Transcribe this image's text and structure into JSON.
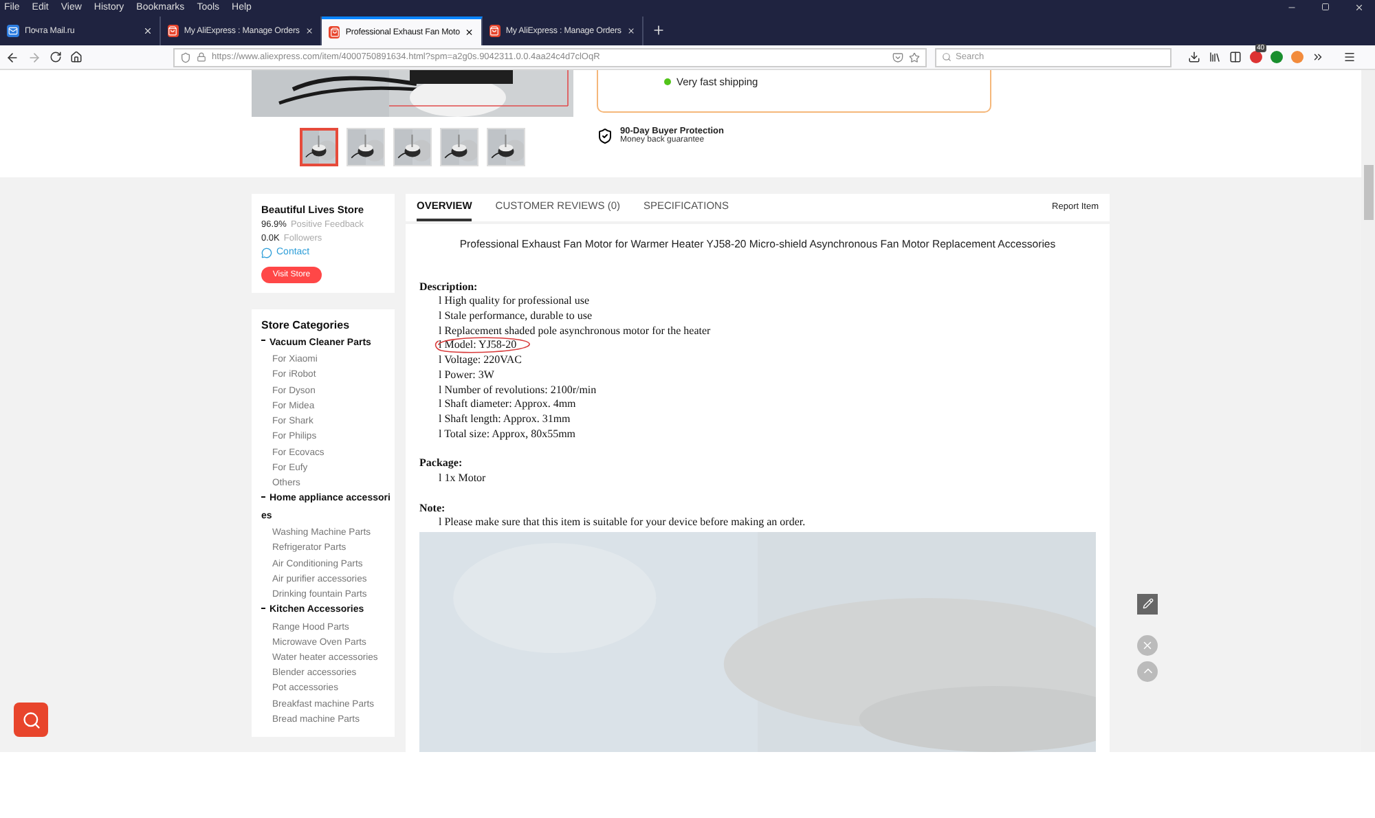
{
  "menu": [
    "File",
    "Edit",
    "View",
    "History",
    "Bookmarks",
    "Tools",
    "Help"
  ],
  "tabs": [
    {
      "title": "Почта Mail.ru",
      "kind": "mail",
      "selected": false
    },
    {
      "title": "My AliExpress : Manage Orders",
      "kind": "shop",
      "selected": false
    },
    {
      "title": "Professional Exhaust Fan Moto",
      "kind": "shop",
      "selected": true
    },
    {
      "title": "My AliExpress : Manage Orders",
      "kind": "shop",
      "selected": false
    }
  ],
  "address": {
    "url": "https://www.aliexpress.com/item/4000750891634.html?spm=a2g0s.9042311.0.0.4aa24c4d7clOqR"
  },
  "search": {
    "placeholder": "Search"
  },
  "extension_badge": "40",
  "product": {
    "shipping": "Very fast shipping",
    "protection_title": "90-Day Buyer Protection",
    "protection_subtitle": "Money back guarantee",
    "thumbnails": [
      {
        "selected": true
      },
      {
        "selected": false
      },
      {
        "selected": false
      },
      {
        "selected": false
      },
      {
        "selected": false
      }
    ]
  },
  "store": {
    "name": "Beautiful Lives Store",
    "feedback_value": "96.9%",
    "feedback_label": "Positive Feedback",
    "followers_value": "0.0K",
    "followers_label": "Followers",
    "contact": "Contact",
    "visit": "Visit Store"
  },
  "categories": {
    "title": "Store Categories",
    "groups": [
      {
        "name": "Vacuum Cleaner Parts",
        "items": [
          "For Xiaomi",
          "For iRobot",
          "For Dyson",
          "For Midea",
          "For Shark",
          "For Philips",
          "For Ecovacs",
          "For Eufy",
          "Others"
        ]
      },
      {
        "name": "Home appliance accessories",
        "items": [
          "Washing Machine Parts",
          "Refrigerator Parts",
          "Air Conditioning Parts",
          "Air purifier accessories",
          "Drinking fountain Parts"
        ]
      },
      {
        "name": "Kitchen Accessories",
        "items": [
          "Range Hood Parts",
          "Microwave Oven Parts",
          "Water heater accessories",
          "Blender accessories",
          "Pot accessories",
          "Breakfast machine Parts",
          "Bread machine Parts"
        ]
      }
    ]
  },
  "detail": {
    "tabs": [
      {
        "label": "OVERVIEW",
        "selected": true
      },
      {
        "label": "CUSTOMER REVIEWS (0)",
        "selected": false
      },
      {
        "label": "SPECIFICATIONS",
        "selected": false
      }
    ],
    "report": "Report Item",
    "title": "Professional Exhaust Fan Motor for Warmer Heater YJ58-20 Micro-shield Asynchronous Fan Motor Replacement Accessories",
    "sections": [
      {
        "heading": "Description:",
        "lines": [
          {
            "text": "l High quality for professional use",
            "circled": false
          },
          {
            "text": "l Stale performance, durable to use",
            "circled": false
          },
          {
            "text": "l Replacement shaded pole asynchronous motor for the heater",
            "circled": false
          },
          {
            "text": "l Model: YJ58-20",
            "circled": true
          },
          {
            "text": "l Voltage: 220VAC",
            "circled": false
          },
          {
            "text": "l Power: 3W",
            "circled": false
          },
          {
            "text": "l Number of revolutions: 2100r/min",
            "circled": false
          },
          {
            "text": "l Shaft diameter: Approx. 4mm",
            "circled": false
          },
          {
            "text": "l Shaft length: Approx. 31mm",
            "circled": false
          },
          {
            "text": "l Total size: Approx, 80x55mm",
            "circled": false
          }
        ]
      },
      {
        "heading": "Package:",
        "lines": [
          {
            "text": "l 1x Motor",
            "circled": false
          }
        ]
      },
      {
        "heading": "Note:",
        "lines": [
          {
            "text": "l Please make sure that this item is suitable for your device before making an order.",
            "circled": false
          }
        ]
      }
    ]
  }
}
